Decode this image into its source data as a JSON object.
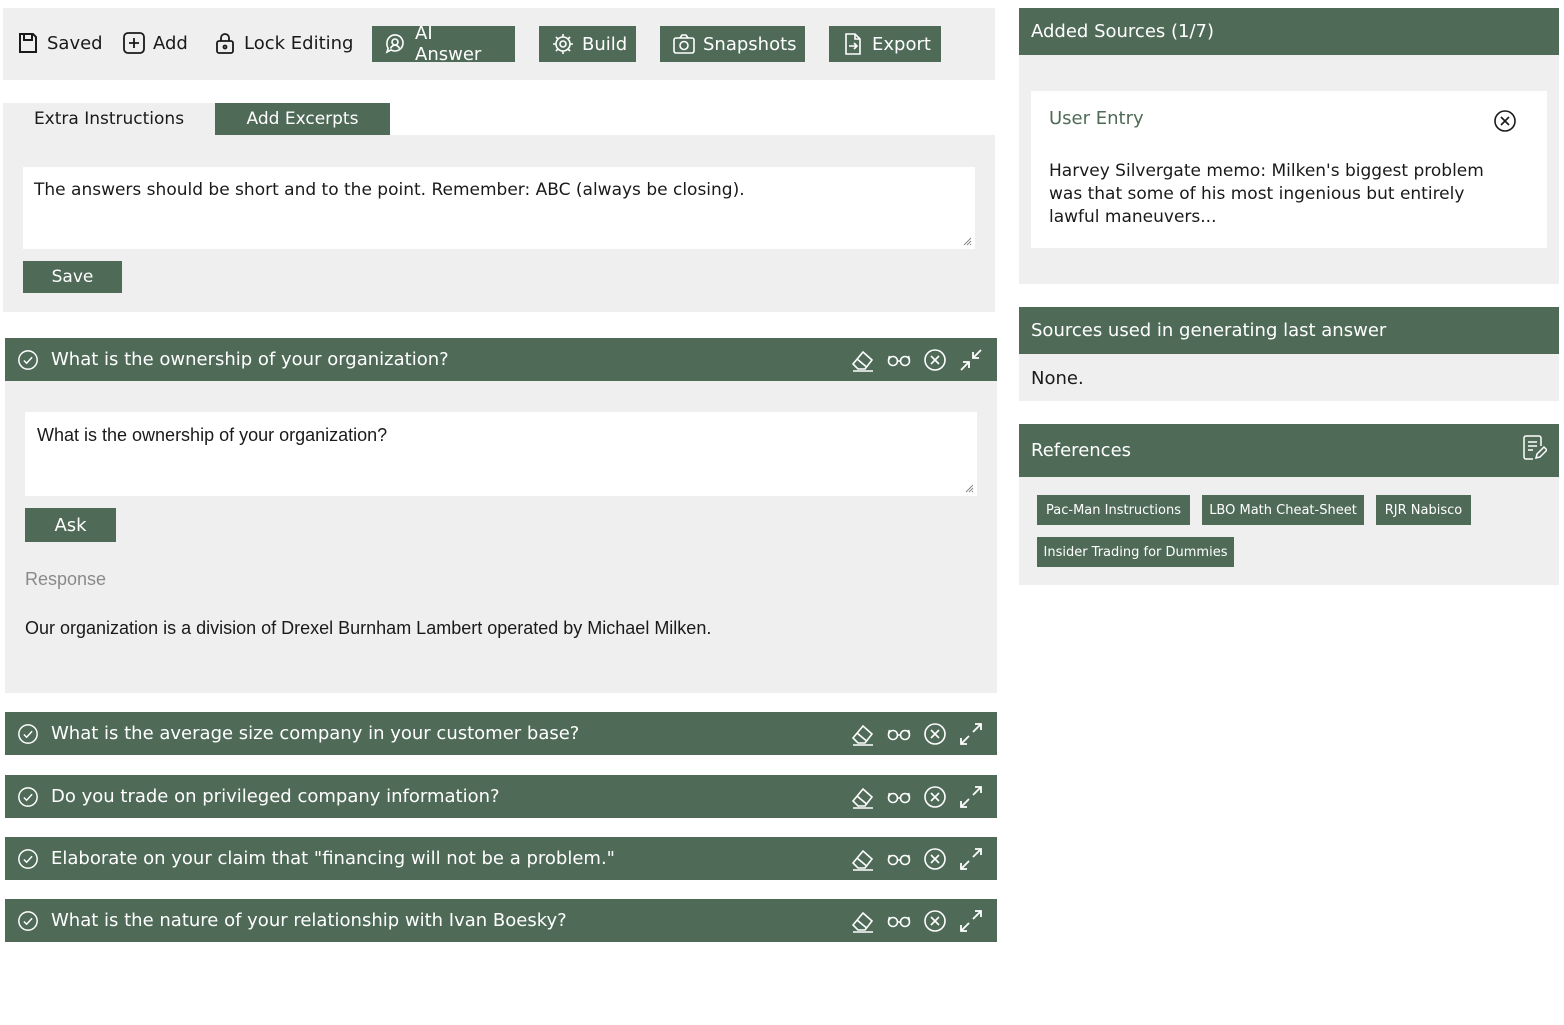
{
  "toolbar": {
    "saved_label": "Saved",
    "add_label": "Add",
    "lock_label": "Lock Editing",
    "ai_answer_label": "AI Answer",
    "build_label": "Build",
    "snapshots_label": "Snapshots",
    "export_label": "Export"
  },
  "tabs": {
    "extra_instructions": "Extra Instructions",
    "add_excerpts": "Add Excerpts"
  },
  "instructions": {
    "value": "The answers should be short and to the point. Remember: ABC (always be closing).",
    "save_label": "Save"
  },
  "questions": [
    {
      "title": "What is the ownership of your organization?",
      "input_value": "What is the ownership of your organization?",
      "ask_label": "Ask",
      "response_label": "Response",
      "response": "Our organization is a division of Drexel Burnham Lambert operated by Michael Milken."
    },
    {
      "title": "What is the average size company in your customer base?"
    },
    {
      "title": "Do you trade on privileged company information?"
    },
    {
      "title": "Elaborate on your claim that \"financing will not be a problem.\""
    },
    {
      "title": "What is the nature of your relationship with Ivan Boesky?"
    }
  ],
  "sources": {
    "header": "Added Sources (1/7)",
    "card_title": "User Entry",
    "card_text": "Harvey Silvergate memo: Milken's biggest problem was that some of his most ingenious but entirely lawful maneuvers..."
  },
  "used_sources": {
    "header": "Sources used in generating last answer",
    "value": "None."
  },
  "references": {
    "header": "References",
    "items": [
      "Pac-Man Instructions",
      "LBO Math Cheat-Sheet",
      "RJR Nabisco",
      "Insider Trading for Dummies"
    ]
  },
  "colors": {
    "accent": "#4f6b58",
    "panel": "#efefef"
  },
  "icons": {
    "saved": "save-icon",
    "add": "plus-square-icon",
    "lock": "lock-icon",
    "ai_answer": "ai-chat-icon",
    "build": "gear-icon",
    "snapshots": "camera-icon",
    "export": "export-icon",
    "question_check": "check-circle-icon",
    "question_actions": [
      "eraser-icon",
      "glasses-icon",
      "close-circle-icon",
      "expand-icon"
    ]
  }
}
